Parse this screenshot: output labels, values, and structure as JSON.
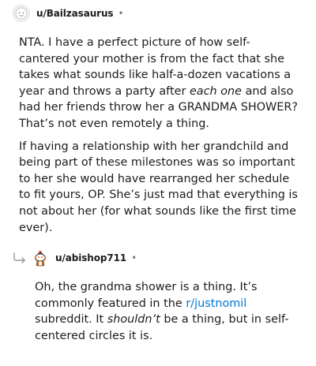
{
  "comment1": {
    "username": "u/Bailzasaurus",
    "separator": "•",
    "paragraph1": {
      "before_emphasis": "NTA. I have a perfect picture of how self-cantered your mother is from the fact that she takes what sounds like half-a-dozen vacations a year and throws a party after ",
      "emphasis": "each one",
      "after_emphasis": " and also had her friends throw her a GRANDMA SHOWER? That’s not even remotely a thing."
    },
    "paragraph2": "If having a relationship with her grandchild and being part of these milestones was so important to her she would have rearranged her schedule to fit yours, OP. She’s just mad that everything is not about her (for what sounds like the first time ever)."
  },
  "comment2": {
    "username": "u/abishop711",
    "separator": "•",
    "text_before_link": "Oh, the grandma shower is a thing. It’s commonly featured in the ",
    "link": "r/justnomil",
    "text_after_link": " subreddit. It ",
    "emphasis": "shouldn’t",
    "text_end": " be a thing, but in self-centered circles it is."
  },
  "colors": {
    "text": "#1c1c1c",
    "link": "#0079d3",
    "meta": "#7c7c7c"
  },
  "icons": {
    "comment1_avatar": "default-avatar-icon",
    "comment2_avatar": "snoo-avatar-icon",
    "reply": "reply-arrow-icon"
  }
}
